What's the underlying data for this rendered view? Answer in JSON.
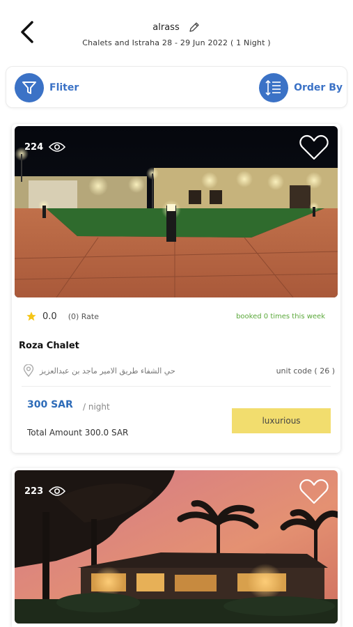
{
  "header": {
    "title": "alrass",
    "subtitle": "Chalets and Istraha  28 - 29 Jun  2022 ( 1 Night )"
  },
  "toolbar": {
    "filter_label": "Fliter",
    "order_label": "Order By"
  },
  "colors": {
    "accent": "#3b72c6",
    "booked_green": "#5aa83a",
    "tag_yellow": "#f2dd6e",
    "star": "#f5c518"
  },
  "listings": [
    {
      "views": "224",
      "rating": "0.0",
      "rate_count": "(0) Rate",
      "booked": "booked 0 times this week",
      "name": "Roza Chalet",
      "location": "حي الشفاء طريق الامير ماجد بن عبدالعزيز",
      "unit_code": "unit code ( 26 )",
      "price": "300 SAR",
      "per_night": "/ night",
      "total": "Total Amount 300.0 SAR",
      "tag": "luxurious"
    },
    {
      "views": "223"
    }
  ]
}
